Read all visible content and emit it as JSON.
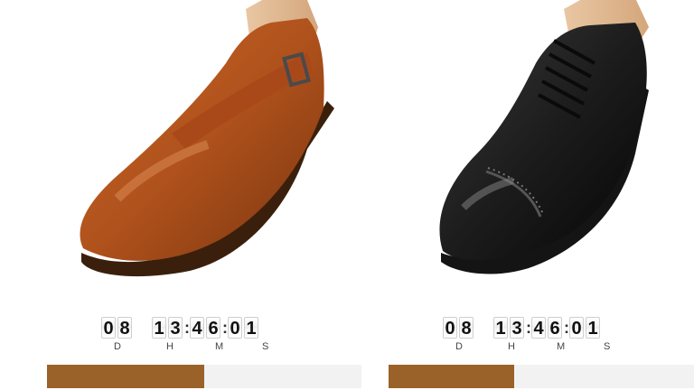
{
  "products": [
    {
      "name": "brown-monk-strap-shoe",
      "timer": {
        "days": "08",
        "hours": "13",
        "minutes": "46",
        "seconds": "01"
      },
      "labels": {
        "days": "D",
        "hours": "H",
        "minutes": "M",
        "seconds": "S"
      },
      "progress": 0.5,
      "colors": {
        "progress": "#9a6228",
        "track": "#f2f2f2"
      }
    },
    {
      "name": "black-oxford-shoe",
      "timer": {
        "days": "08",
        "hours": "13",
        "minutes": "46",
        "seconds": "01"
      },
      "labels": {
        "days": "D",
        "hours": "H",
        "minutes": "M",
        "seconds": "S"
      },
      "progress": 0.4,
      "colors": {
        "progress": "#9a6228",
        "track": "#f2f2f2"
      }
    }
  ]
}
